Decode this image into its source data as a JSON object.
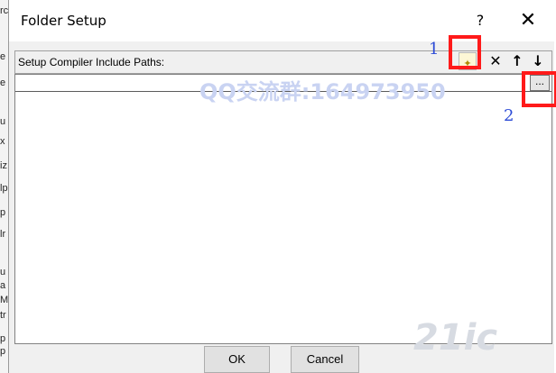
{
  "background_app": {
    "side_chars": [
      "rc",
      "e",
      "e",
      "u",
      "x",
      "iz",
      "lp",
      "p",
      "lr",
      "u",
      "a",
      "M",
      "tr",
      "p",
      "p"
    ]
  },
  "dialog": {
    "title": "Folder Setup",
    "help_label": "?",
    "close_label": "✕"
  },
  "toolbar": {
    "header_label": "Setup Compiler Include Paths:",
    "new_icon_glyph": "✦",
    "delete_icon_glyph": "✕",
    "up_icon_glyph": "↑",
    "down_icon_glyph": "↓"
  },
  "path_list": {
    "current_value": "",
    "browse_label": "..."
  },
  "annotations": {
    "label_1": "1",
    "label_2": "2",
    "watermark": "QQ交流群:164973950",
    "highlight_color": "#ff1a1a",
    "number_color": "#2c4bd6"
  },
  "footer": {
    "ok_label": "OK",
    "cancel_label": "Cancel"
  },
  "brand": {
    "logo_text": "21ic"
  }
}
